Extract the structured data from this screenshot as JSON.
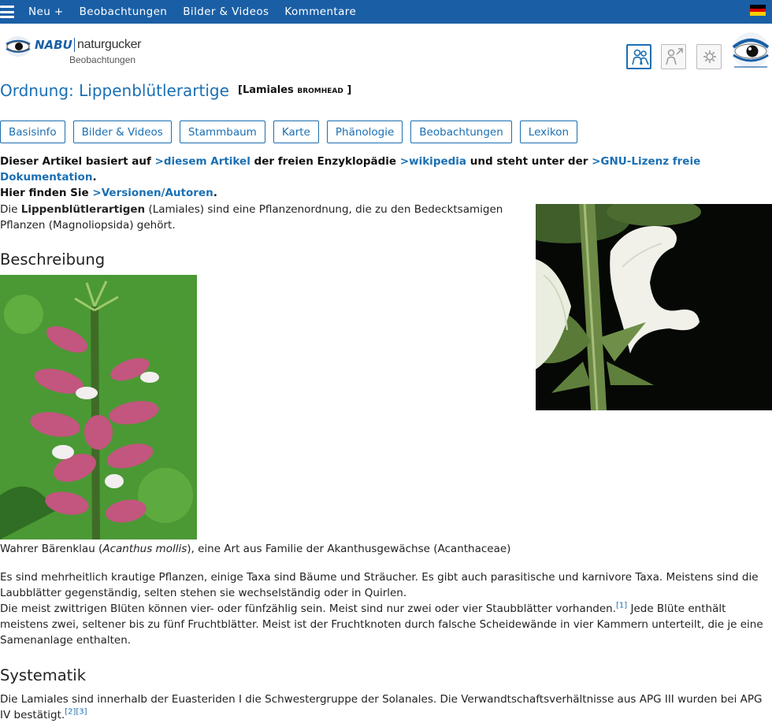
{
  "topnav": {
    "items": [
      "Neu +",
      "Beobachtungen",
      "Bilder & Videos",
      "Kommentare"
    ]
  },
  "logo": {
    "brand": "NABU",
    "app": "naturgucker",
    "sub": "Beobachtungen"
  },
  "tools": [
    "people-icon",
    "person-arrow-icon",
    "gear-icon"
  ],
  "heading": {
    "title": "Ordnung: Lippenblütlerartige",
    "author_prefix": "[Lamiales",
    "author_name": "Bromhead",
    "author_suffix": "]"
  },
  "tabs": [
    "Basisinfo",
    "Bilder & Videos",
    "Stammbaum",
    "Karte",
    "Phänologie",
    "Beobachtungen",
    "Lexikon"
  ],
  "license": {
    "t1": "Dieser Artikel basiert auf ",
    "l1": ">diesem Artikel",
    "t2": " der freien Enzyklopädie ",
    "l2": ">wikipedia",
    "t3": " und steht unter der ",
    "l3": ">GNU-Lizenz freie Dokumentation",
    "t4": ".",
    "t5": "Hier finden Sie ",
    "l4": ">Versionen/Autoren",
    "t6": "."
  },
  "intro": {
    "t1": "Die ",
    "bold": "Lippenblütlerartigen",
    "t2": " (Lamiales) sind eine Pflanzenordnung, die zu den Bedecktsamigen Pflanzen (Magnoliopsida) gehört."
  },
  "sections": {
    "beschreibung": "Beschreibung",
    "systematik": "Systematik"
  },
  "caption": {
    "t1": "Wahrer Bärenklau (",
    "italic": "Acanthus mollis",
    "t2": "), eine Art aus Familie der Akanthusgewächse (Acanthaceae)"
  },
  "para1": {
    "line_a": "Es sind mehrheitlich krautige Pflanzen, einige Taxa sind Bäume und Sträucher. Es gibt auch parasitische und karnivore Taxa. Meistens sind die Laubblätter gegenständig, selten stehen sie wechselständig oder in Quirlen.",
    "line_b": "Die meist zwittrigen Blüten können vier- oder fünfzählig sein. Meist sind nur zwei oder vier Staubblätter vorhanden.",
    "ref1": "[1]",
    "line_c": " Jede Blüte enthält meistens zwei, seltener bis zu fünf Fruchtblätter. Meist ist der Fruchtknoten durch falsche Scheidewände in vier Kammern unterteilt, die je eine Samenanlage enthalten."
  },
  "para2": {
    "text": "Die Lamiales sind innerhalb der Euasteriden I die Schwestergruppe der Solanales. Die Verwandtschaftsverhältnisse aus APG III wurden bei APG IV bestätigt.",
    "refs": "[2][3]"
  },
  "colors": {
    "topbar": "#1a5fa6",
    "link": "#1a6fb3"
  }
}
